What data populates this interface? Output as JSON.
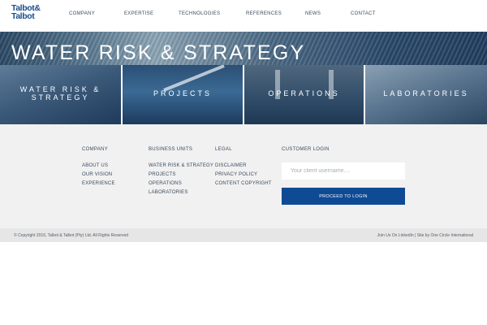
{
  "header": {
    "logo_line1": "Talbot&",
    "logo_line2": "Talbot",
    "nav": [
      "COMPANY",
      "EXPERTISE",
      "TECHNOLOGIES",
      "REFERENCES",
      "NEWS",
      "CONTACT"
    ]
  },
  "banner": {
    "title": "WATER RISK & STRATEGY"
  },
  "tiles": [
    {
      "line1": "WATER RISK &",
      "line2": "STRATEGY"
    },
    {
      "line1": "PROJECTS"
    },
    {
      "line1": "OPERATIONS"
    },
    {
      "line1": "LABORATORIES"
    }
  ],
  "footer": {
    "company": {
      "heading": "COMPANY",
      "links": [
        "ABOUT US",
        "OUR VISION",
        "EXPERIENCE"
      ]
    },
    "business_units": {
      "heading": "BUSINESS UNITS",
      "links": [
        "WATER RISK & STRATEGY",
        "PROJECTS",
        "OPERATIONS",
        "LABORATORIES"
      ]
    },
    "legal": {
      "heading": "LEGAL",
      "links": [
        "DISCLAIMER",
        "PRIVACY POLICY",
        "CONTENT COPYRIGHT"
      ]
    },
    "login": {
      "heading": "CUSTOMER LOGIN",
      "placeholder": "Your client username....",
      "button": "PROCEED TO LOGIN"
    }
  },
  "bottom": {
    "copyright": "© Copyright 2016, Talbot & Talbot (Pty) Ltd. All Rights Reserved",
    "linkedin": "Join Us On LinkedIn",
    "separator": " | Site by ",
    "site_by": "One Circle International"
  },
  "colors": {
    "brand_blue": "#1b4f8c",
    "button_blue": "#0f4a95",
    "footer_bg": "#f1f1f1"
  }
}
